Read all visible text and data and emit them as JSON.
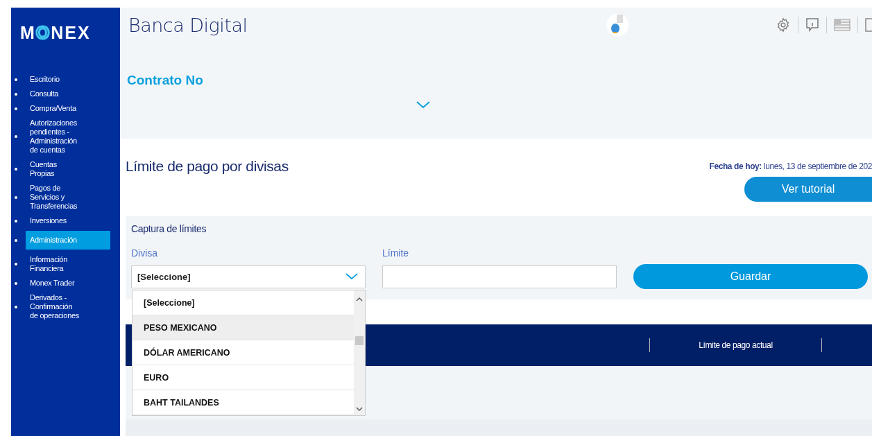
{
  "logo": "MONEX",
  "sidebar": {
    "items": [
      {
        "label": "Escritorio",
        "selected": false
      },
      {
        "label": "Consulta",
        "selected": false
      },
      {
        "label": "Compra/Venta",
        "selected": false
      },
      {
        "label": "Autorizaciones pendientes - Administración de cuentas",
        "selected": false
      },
      {
        "label": "Cuentas Propias",
        "selected": false
      },
      {
        "label": "Pagos de Servicios y Transferencias",
        "selected": false
      },
      {
        "label": "Inversiones",
        "selected": false
      },
      {
        "label": "Administración",
        "selected": true
      },
      {
        "label": "Información Financiera",
        "selected": false
      },
      {
        "label": "Monex Trader",
        "selected": false
      },
      {
        "label": "Derivados - Confirmación de operaciones",
        "selected": false
      }
    ]
  },
  "header": {
    "title": "Banca Digital",
    "contract_label": "Contrato No"
  },
  "page": {
    "title": "Límite de pago por divisas",
    "date": "**Fecha de hoy:** lunes, 13 de septiembre de 202",
    "tutorial_button": "Ver tutorial"
  },
  "form": {
    "title": "Captura de límites",
    "currency_label": "Divisa",
    "currency_value": "[Seleccione]",
    "limit_label": "Límite",
    "save_button": "Guardar",
    "options": [
      {
        "label": "[Seleccione]",
        "highlighted": false
      },
      {
        "label": "PESO MEXICANO",
        "highlighted": true
      },
      {
        "label": "DÓLAR AMERICANO",
        "highlighted": false
      },
      {
        "label": "EURO",
        "highlighted": false
      },
      {
        "label": "BAHT TAILANDES",
        "highlighted": false
      }
    ]
  },
  "table": {
    "columns": [
      "Límite de pago actual"
    ]
  }
}
